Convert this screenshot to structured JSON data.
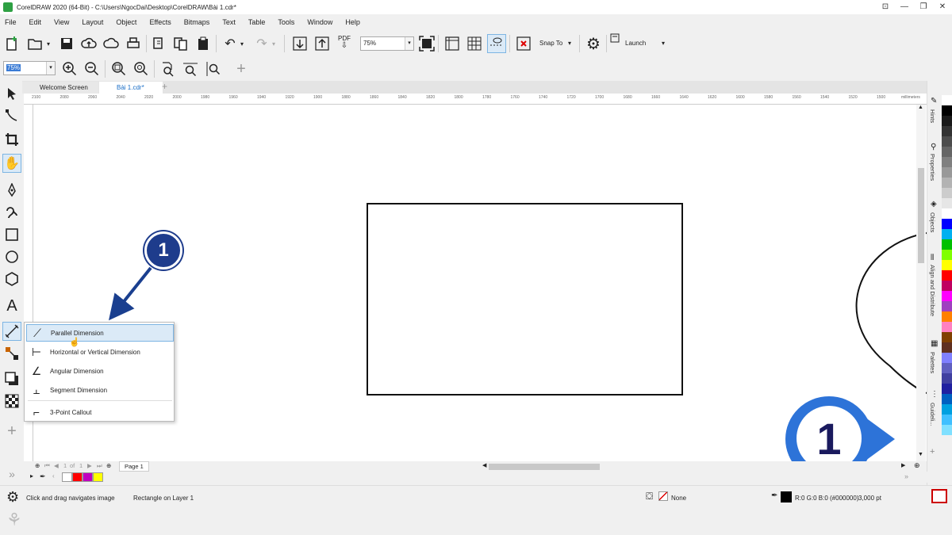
{
  "window": {
    "title": "CorelDRAW 2020 (64-Bit) - C:\\Users\\NgocDai\\Desktop\\CorelDRAW\\Bài 1.cdr*",
    "controls": [
      "⊡",
      "—",
      "❐",
      "✕"
    ]
  },
  "menu": [
    "File",
    "Edit",
    "View",
    "Layout",
    "Object",
    "Effects",
    "Bitmaps",
    "Text",
    "Table",
    "Tools",
    "Window",
    "Help"
  ],
  "toolbar": {
    "zoom_value": "75%",
    "pdf_label": "PDF",
    "snap_to": "Snap To",
    "launch": "Launch"
  },
  "property_bar": {
    "zoom_value": "75%"
  },
  "tabs": [
    {
      "label": "Welcome Screen"
    },
    {
      "label": "Bài 1.cdr*"
    }
  ],
  "ruler": {
    "ticks": [
      "2100",
      "2080",
      "2060",
      "2040",
      "2020",
      "2000",
      "1980",
      "1960",
      "1940",
      "1920",
      "1900",
      "1880",
      "1860",
      "1840",
      "1820",
      "1800",
      "1780",
      "1760",
      "1740",
      "1720",
      "1700",
      "1680",
      "1660",
      "1640",
      "1620",
      "1600",
      "1580",
      "1560",
      "1540",
      "1520",
      "1500"
    ],
    "unit": "millimeters"
  },
  "flyout": {
    "items": [
      {
        "label": "Parallel Dimension",
        "icon": "parallel-dimension-icon",
        "selected": true
      },
      {
        "label": "Horizontal or Vertical Dimension",
        "icon": "horizontal-vertical-dimension-icon"
      },
      {
        "label": "Angular Dimension",
        "icon": "angular-dimension-icon"
      },
      {
        "label": "Segment Dimension",
        "icon": "segment-dimension-icon"
      },
      {
        "label": "3-Point Callout",
        "icon": "callout-icon"
      }
    ]
  },
  "annotation": {
    "badge": "1"
  },
  "watermark": {
    "text": "1"
  },
  "dockers": [
    "Hints",
    "Properties",
    "Objects",
    "Align and Distribute",
    "Palettes",
    "Guideli..."
  ],
  "page_nav": {
    "current": "1",
    "of": "of",
    "total": "1",
    "page_tab": "Page 1"
  },
  "status": {
    "hint": "Click and drag navigates image",
    "selection": "Rectangle on Layer 1",
    "fill": "None",
    "outline": "R:0 G:0 B:0 (#000000)",
    "outline_width": "3,000 pt"
  },
  "palette_colors": [
    "#ffffff",
    "#000000",
    "#1a1a1a",
    "#333333",
    "#4d4d4d",
    "#666666",
    "#808080",
    "#999999",
    "#b3b3b3",
    "#cccccc",
    "#e6e6e6",
    "#ffffff",
    "#0000ff",
    "#00b0f0",
    "#00c000",
    "#80ff00",
    "#ffff00",
    "#ff0000",
    "#c00060",
    "#ff00ff",
    "#a040c0",
    "#ff8000",
    "#ff80c0",
    "#804000",
    "#603020",
    "#8080ff",
    "#6060c0",
    "#4040a0",
    "#2020a0",
    "#0060c0",
    "#00a0e0",
    "#40c0ff",
    "#80e0ff"
  ],
  "doc_palette": [
    "#ffffff",
    "#ff0000",
    "#c000c0",
    "#ffff00"
  ]
}
